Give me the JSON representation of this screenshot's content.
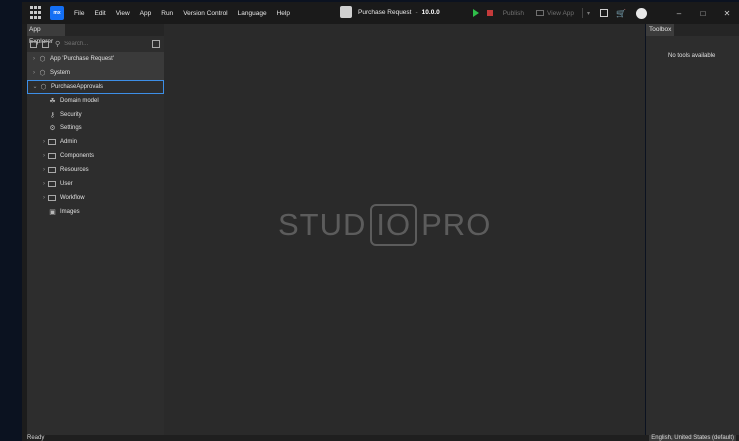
{
  "menu": [
    "File",
    "Edit",
    "View",
    "App",
    "Run",
    "Version Control",
    "Language",
    "Help"
  ],
  "logo_text": "mx",
  "window_title": "Purchase Request",
  "title_sep": "-",
  "version": "10.0.0",
  "toolbar": {
    "publish": "Publish",
    "view_app": "View App"
  },
  "window_controls": {
    "minimize": "–",
    "maximize": "□",
    "close": "✕"
  },
  "left_panel": {
    "tab": "App Explorer",
    "search_placeholder": "Search...",
    "tree": [
      {
        "label": "App 'Purchase Request'",
        "icon": "app-icon",
        "chevron": "›",
        "indent": 0
      },
      {
        "label": "System",
        "icon": "module-icon",
        "chevron": "›",
        "indent": 0
      },
      {
        "label": "PurchaseApprovals",
        "icon": "module-icon",
        "chevron": "⌄",
        "indent": 0,
        "selected": true
      },
      {
        "label": "Domain model",
        "icon": "domain-model-icon",
        "indent": 1
      },
      {
        "label": "Security",
        "icon": "key-icon",
        "indent": 1
      },
      {
        "label": "Settings",
        "icon": "gear-icon",
        "indent": 1
      },
      {
        "label": "Admin",
        "icon": "folder-icon",
        "chevron": "›",
        "indent": 1
      },
      {
        "label": "Components",
        "icon": "folder-icon",
        "chevron": "›",
        "indent": 1
      },
      {
        "label": "Resources",
        "icon": "folder-icon",
        "chevron": "›",
        "indent": 1
      },
      {
        "label": "User",
        "icon": "folder-icon",
        "chevron": "›",
        "indent": 1
      },
      {
        "label": "Workflow",
        "icon": "folder-icon",
        "chevron": "›",
        "indent": 1
      },
      {
        "label": "Images",
        "icon": "images-icon",
        "indent": 1
      }
    ]
  },
  "editor": {
    "wm_left": "STUD",
    "wm_box": "IO",
    "wm_right": "PRO"
  },
  "right_panel": {
    "tab": "Toolbox",
    "empty_text": "No tools available"
  },
  "status": {
    "left": "Ready",
    "language": "English, United States (default)"
  }
}
